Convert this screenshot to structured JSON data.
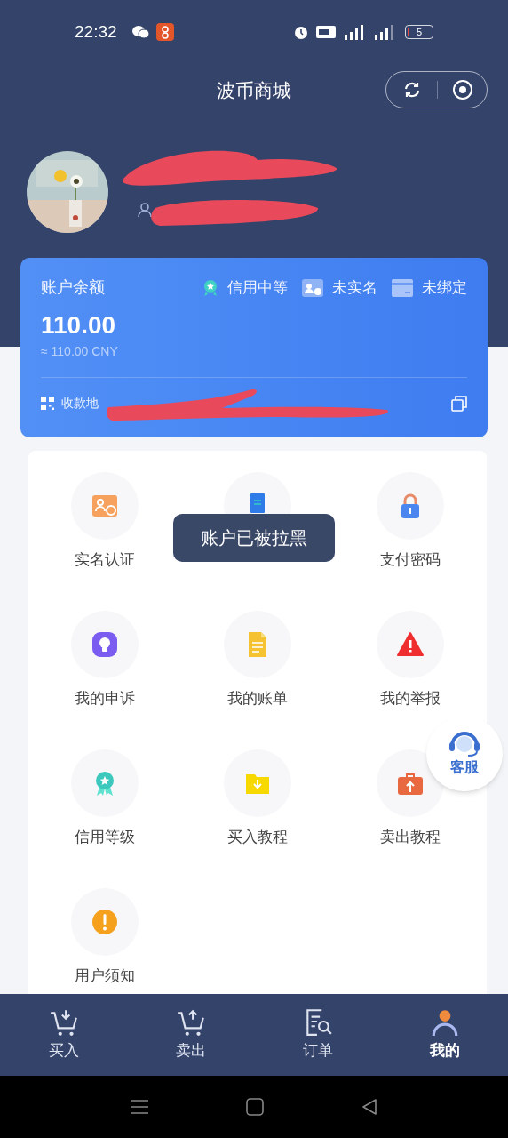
{
  "status_bar": {
    "time": "22:32",
    "battery": "5"
  },
  "header": {
    "title": "波币商城"
  },
  "balance_card": {
    "label": "账户余额",
    "badges": [
      {
        "kind": "credit",
        "label": "信用中等"
      },
      {
        "kind": "identity",
        "label": "未实名"
      },
      {
        "kind": "card",
        "label": "未绑定"
      }
    ],
    "amount": "110.00",
    "converted": "≈ 110.00 CNY",
    "address_label": "收款地"
  },
  "menu": [
    {
      "kind": "id-card",
      "label": "实名认证"
    },
    {
      "kind": "payment"
    },
    {
      "kind": "lock",
      "label": "支付密码"
    },
    {
      "kind": "appeal",
      "label": "我的申诉"
    },
    {
      "kind": "bill",
      "label": "我的账单"
    },
    {
      "kind": "warning",
      "label": "我的举报"
    },
    {
      "kind": "badge",
      "label": "信用等级"
    },
    {
      "kind": "folder",
      "label": "买入教程"
    },
    {
      "kind": "briefcase",
      "label": "卖出教程"
    },
    {
      "kind": "notice",
      "label": "用户须知"
    }
  ],
  "toast": "账户已被拉黑",
  "support_button": "客服",
  "tabs": [
    {
      "kind": "buy",
      "label": "买入",
      "selected": false
    },
    {
      "kind": "sell",
      "label": "卖出",
      "selected": false
    },
    {
      "kind": "orders",
      "label": "订单",
      "selected": false
    },
    {
      "kind": "me",
      "label": "我的",
      "selected": true
    }
  ]
}
